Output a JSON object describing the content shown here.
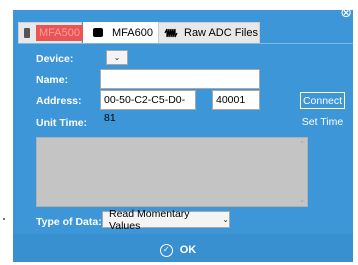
{
  "tabs": [
    {
      "label": "MFA500",
      "icon": "device-icon"
    },
    {
      "label": "MFA600",
      "icon": "device-icon"
    },
    {
      "label": "Raw ADC Files",
      "icon": "waveform-icon"
    }
  ],
  "form": {
    "device_label": "Device:",
    "name_label": "Name:",
    "address_label": "Address:",
    "unit_time_label": "Unit Time:",
    "device_value": "",
    "name_value": "",
    "address_value": "00-50-C2-C5-D0-81",
    "port_value": "40001",
    "type_label": "Type of Data:",
    "type_value": "Read Momentary Values"
  },
  "buttons": {
    "connect": "Connect",
    "set_time": "Set Time",
    "ok": "OK"
  },
  "colors": {
    "dialog_bg": "#3d96d8",
    "mfa500_highlight": "#e85555"
  }
}
